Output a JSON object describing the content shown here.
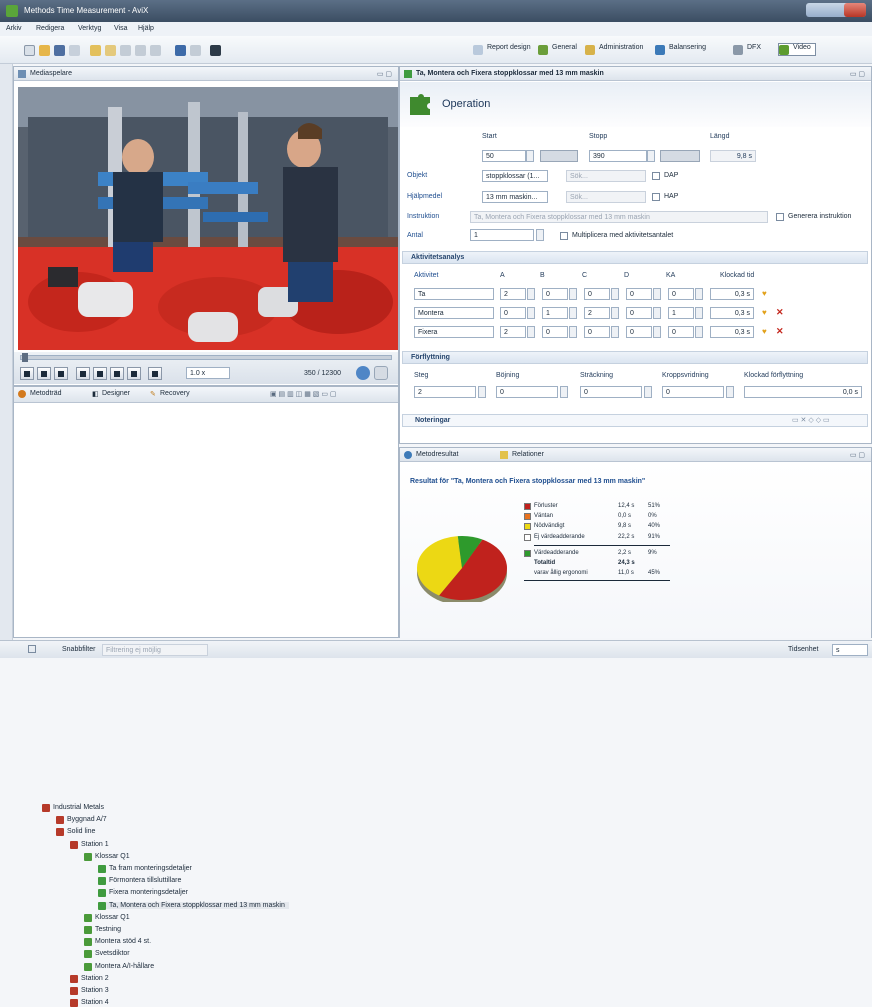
{
  "window": {
    "title": "Methods Time Measurement - AviX"
  },
  "menu": [
    "Arkiv",
    "Redigera",
    "Verktyg",
    "Visa",
    "Hjälp"
  ],
  "perspectives": [
    "Report design",
    "General",
    "Administration",
    "Balansering",
    "DFX",
    "Video"
  ],
  "media": {
    "tab": "Mediaspelare",
    "time": "350 / 12300",
    "speed": "1.0 x"
  },
  "operation_tab": "Ta, Montera och Fixera stoppklossar med 13 mm maskin",
  "operation": {
    "heading": "Operation",
    "start_label": "Start",
    "stop_label": "Stopp",
    "length_label": "Längd",
    "start": "50",
    "stop": "390",
    "length": "9,8 s",
    "object_label": "Objekt",
    "object": "stoppklossar (1...",
    "object_hint": "Sök...",
    "tool_label": "Hjälpmedel",
    "tool": "13 mm maskin...",
    "tool_hint": "Sök...",
    "dap": "DAP",
    "hap": "HAP",
    "instr_label": "Instruktion",
    "instr": "Ta, Montera och Fixera stoppklossar med 13 mm maskin",
    "generate": "Generera instruktion",
    "count_label": "Antal",
    "count": "1",
    "multiply": "Multiplicera med aktivitetsantalet"
  },
  "activity": {
    "title": "Aktivitetsanalys",
    "cols": [
      "Aktivitet",
      "A",
      "B",
      "C",
      "D",
      "KA",
      "Klockad tid"
    ],
    "rows": [
      {
        "name": "Ta",
        "a": "2",
        "b": "0",
        "c": "0",
        "d": "0",
        "ka": "0",
        "time": "0,3 s"
      },
      {
        "name": "Montera",
        "a": "0",
        "b": "1",
        "c": "2",
        "d": "0",
        "ka": "1",
        "time": "0,3 s"
      },
      {
        "name": "Fixera",
        "a": "2",
        "b": "0",
        "c": "0",
        "d": "0",
        "ka": "0",
        "time": "0,3 s"
      }
    ]
  },
  "move": {
    "title": "Förflyttning",
    "cols": [
      "Steg",
      "Böjning",
      "Sträckning",
      "Kroppsvridning",
      "Klockad förflyttning"
    ],
    "vals": [
      "2",
      "0",
      "0",
      "0",
      "0,0 s"
    ]
  },
  "notes": "Noteringar",
  "tree": {
    "tabs": [
      "Metodträd",
      "Designer",
      "Recovery"
    ],
    "items": [
      {
        "label": "Industrial Metals",
        "indent": 0,
        "color": "#b63a2a"
      },
      {
        "label": "Byggnad A/7",
        "indent": 1,
        "color": "#b63a2a"
      },
      {
        "label": "Solid line",
        "indent": 1,
        "color": "#b63a2a"
      },
      {
        "label": "Station 1",
        "indent": 2,
        "color": "#b63a2a"
      },
      {
        "label": "Klossar Q1",
        "indent": 3,
        "color": "#4a9a3a"
      },
      {
        "label": "Ta fram monteringsdetaljer",
        "indent": 4,
        "color": "#3f9b3f"
      },
      {
        "label": "Förmontera tillsluttillare",
        "indent": 4,
        "color": "#3f9b3f"
      },
      {
        "label": "Fixera monteringsdetaljer",
        "indent": 4,
        "color": "#3f9b3f"
      },
      {
        "label": "Ta, Montera och Fixera stoppklossar med 13 mm maskin",
        "indent": 4,
        "color": "#3f9b3f",
        "sel": true
      },
      {
        "label": "Klossar Q1",
        "indent": 3,
        "color": "#4a9a3a"
      },
      {
        "label": "Testning",
        "indent": 3,
        "color": "#4a9a3a"
      },
      {
        "label": "Montera stöd 4 st.",
        "indent": 3,
        "color": "#4a9a3a"
      },
      {
        "label": "Svetsdiktor",
        "indent": 3,
        "color": "#4a9a3a"
      },
      {
        "label": "Montera A/I-hållare",
        "indent": 3,
        "color": "#4a9a3a"
      },
      {
        "label": "Station 2",
        "indent": 2,
        "color": "#b63a2a"
      },
      {
        "label": "Station 3",
        "indent": 2,
        "color": "#b63a2a"
      },
      {
        "label": "Station 4",
        "indent": 2,
        "color": "#b63a2a"
      }
    ]
  },
  "result": {
    "tabs": [
      "Metodresultat",
      "Relationer"
    ],
    "heading": "Resultat för \"Ta, Montera och Fixera stoppklossar med 13 mm maskin\"",
    "legend": [
      {
        "label": "Förluster",
        "value": "12,4 s",
        "pct": "51%",
        "color": "#c0221d"
      },
      {
        "label": "Väntan",
        "value": "0,0 s",
        "pct": "0%",
        "color": "#e8721e"
      },
      {
        "label": "Nödvändigt",
        "value": "9,8 s",
        "pct": "40%",
        "color": "#ecd814"
      },
      {
        "label": "Ej värdeadderande",
        "value": "22,2 s",
        "pct": "91%",
        "color": "#ffffff"
      },
      {
        "label": "Värdeadderande",
        "value": "2,2 s",
        "pct": "9%",
        "color": "#2e9a2c"
      },
      {
        "label": "Totaltid",
        "value": "24,3 s",
        "pct": "",
        "color": ""
      },
      {
        "label": "varav ållig ergonomi",
        "value": "11,0 s",
        "pct": "45%",
        "color": ""
      }
    ]
  },
  "chart_data": {
    "type": "pie",
    "categories": [
      "Förluster",
      "Väntan",
      "Nödvändigt",
      "Värdeadderande"
    ],
    "values": [
      51,
      0,
      40,
      9
    ],
    "colors": [
      "#c0221d",
      "#e8721e",
      "#ecd814",
      "#2e9a2c"
    ]
  },
  "status": {
    "label": "Snabbfilter",
    "hint": "Filtrering ej möjlig",
    "right": "Tidsenhet",
    "unit": "s"
  }
}
